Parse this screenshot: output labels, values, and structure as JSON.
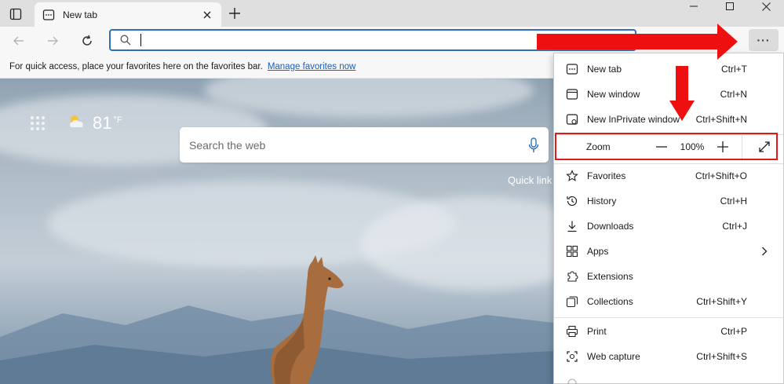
{
  "tab": {
    "title": "New tab"
  },
  "address": {
    "value": ""
  },
  "toolbar": {
    "more_label": "···"
  },
  "favbar": {
    "text": "For quick access, place your favorites here on the favorites bar.",
    "link": "Manage favorites now"
  },
  "newtab_page": {
    "temperature": "81",
    "unit": "°F",
    "search_placeholder": "Search the web",
    "quick_links": "Quick link"
  },
  "menu": {
    "items_top": [
      {
        "label": "New tab",
        "shortcut": "Ctrl+T",
        "icon": "new-tab-icon"
      },
      {
        "label": "New window",
        "shortcut": "Ctrl+N",
        "icon": "new-window-icon"
      },
      {
        "label": "New InPrivate window",
        "shortcut": "Ctrl+Shift+N",
        "icon": "inprivate-icon"
      }
    ],
    "zoom": {
      "label": "Zoom",
      "value": "100%"
    },
    "items_mid": [
      {
        "label": "Favorites",
        "shortcut": "Ctrl+Shift+O",
        "icon": "favorites-icon"
      },
      {
        "label": "History",
        "shortcut": "Ctrl+H",
        "icon": "history-icon"
      },
      {
        "label": "Downloads",
        "shortcut": "Ctrl+J",
        "icon": "download-icon"
      },
      {
        "label": "Apps",
        "shortcut": "",
        "icon": "apps-icon"
      },
      {
        "label": "Extensions",
        "shortcut": "",
        "icon": "extensions-icon"
      },
      {
        "label": "Collections",
        "shortcut": "Ctrl+Shift+Y",
        "icon": "collections-icon"
      }
    ],
    "items_bottom": [
      {
        "label": "Print",
        "shortcut": "Ctrl+P",
        "icon": "print-icon"
      },
      {
        "label": "Web capture",
        "shortcut": "Ctrl+Shift+S",
        "icon": "web-capture-icon"
      }
    ]
  },
  "colors": {
    "accent": "#2f6fb5",
    "highlight": "#e01a1a",
    "arrow": "#ee1010"
  }
}
